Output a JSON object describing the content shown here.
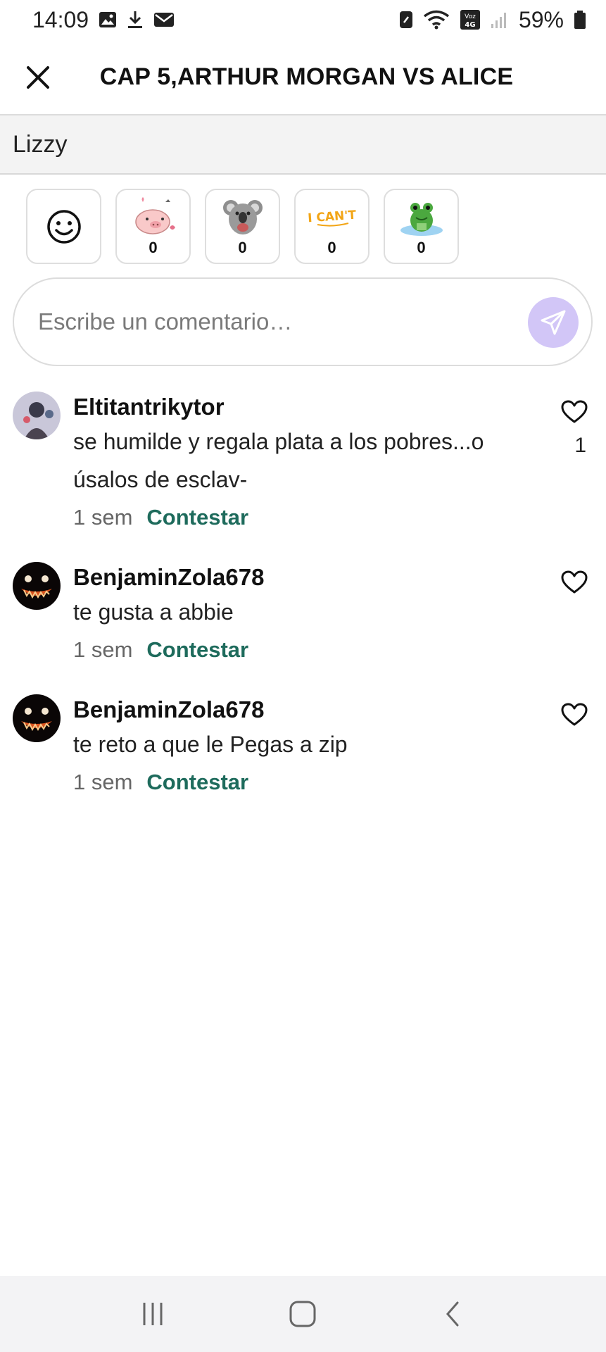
{
  "status_bar": {
    "time": "14:09",
    "battery": "59%",
    "network_label": "Voz 4G"
  },
  "header": {
    "title": "CAP 5,ARTHUR MORGAN VS ALICE"
  },
  "author": {
    "name": "Lizzy"
  },
  "reactions": [
    {
      "icon": "smiley-icon"
    },
    {
      "icon": "pig-sticker-icon",
      "count": "0"
    },
    {
      "icon": "koala-sticker-icon",
      "count": "0"
    },
    {
      "icon": "i-cant-sticker-icon",
      "count": "0"
    },
    {
      "icon": "frog-sticker-icon",
      "count": "0"
    }
  ],
  "comment_input": {
    "placeholder": "Escribe un comentario…"
  },
  "comments": [
    {
      "user": "Eltitantrikytor",
      "text_line1": "se humilde y regala plata a los pobres...o",
      "text_line2": "úsalos de esclav-",
      "time": "1 sem",
      "reply": "Contestar",
      "likes": "1"
    },
    {
      "user": "BenjaminZola678",
      "text_line1": "te gusta a abbie",
      "time": "1 sem",
      "reply": "Contestar"
    },
    {
      "user": "BenjaminZola678",
      "text_line1": "te reto a que le Pegas a zip",
      "time": "1 sem",
      "reply": "Contestar"
    }
  ],
  "colors": {
    "reply": "#1e6b5c",
    "send_button": "#d2c6f7",
    "nav_bar": "#f3f3f5"
  }
}
